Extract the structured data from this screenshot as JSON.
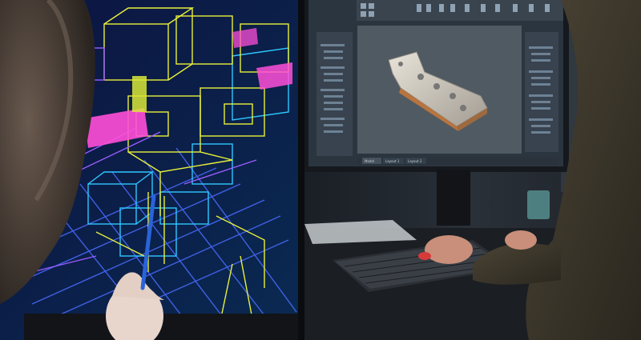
{
  "colors": {
    "wire_yellow": "#e8f03a",
    "wire_cyan": "#2fc7ff",
    "wire_blue": "#4a6bff",
    "wire_magenta": "#ff4fd8",
    "wire_purple": "#9b5cff",
    "cad_bg": "#2b3540",
    "panel_bg": "#38434f",
    "viewport_bg": "#505a63",
    "metal": "#c9c4bb"
  },
  "cad_app": {
    "tabs": [
      "Model",
      "Layout 1",
      "Layout 2"
    ],
    "icons": [
      "toolbar-icon",
      "tree-node-icon",
      "part-model-icon"
    ]
  }
}
